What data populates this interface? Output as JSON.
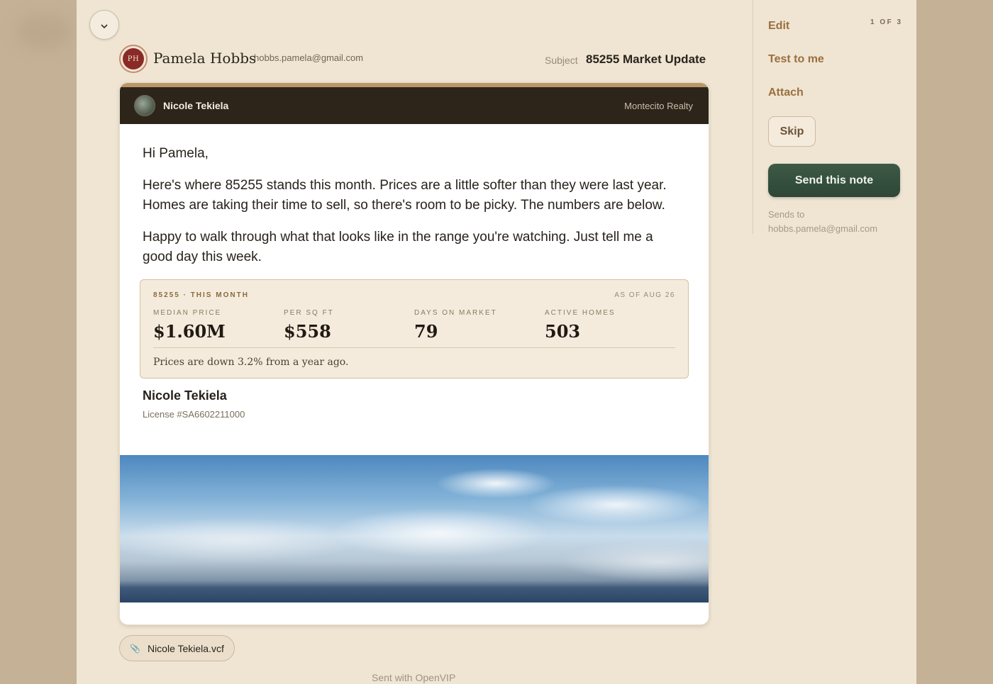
{
  "header": {
    "recipient_initials": "PH",
    "recipient_name": "Pamela Hobbs",
    "recipient_email": "hobbs.pamela@gmail.com",
    "subject_label": "Subject",
    "subject_value": "85255 Market Update"
  },
  "email": {
    "agent_name": "Nicole Tekiela",
    "agency": "Montecito Realty",
    "greeting": "Hi Pamela,",
    "paragraph1": "Here's where 85255 stands this month. Prices are a little softer than they were last year. Homes are taking their time to sell, so there's room to be picky. The numbers are below.",
    "paragraph2": "Happy to walk through what that looks like in the range you're watching. Just tell me a good day this week.",
    "stats": {
      "title": "85255 · THIS MONTH",
      "as_of": "AS OF AUG 26",
      "items": [
        {
          "label": "MEDIAN PRICE",
          "value": "$1.60M"
        },
        {
          "label": "PER SQ FT",
          "value": "$558"
        },
        {
          "label": "DAYS ON MARKET",
          "value": "79"
        },
        {
          "label": "ACTIVE HOMES",
          "value": "503"
        }
      ],
      "note": "Prices are down 3.2% from a year ago."
    },
    "signature_name": "Nicole Tekiela",
    "signature_license": "License #SA6602211000"
  },
  "attachment": {
    "filename": "Nicole Tekiela.vcf",
    "icon": "paperclip-icon"
  },
  "footer": {
    "sent_with": "Sent with OpenVIP"
  },
  "sidebar": {
    "counter": "1 OF 3",
    "edit": "Edit",
    "test": "Test to me",
    "attach": "Attach",
    "skip": "Skip",
    "send": "Send this note",
    "sends_to_label": "Sends to",
    "sends_to_email": "hobbs.pamela@gmail.com"
  },
  "colors": {
    "background": "#c4b196",
    "panel": "#f0e5d3",
    "accent": "#99703f",
    "send_button": "#2e4636",
    "header_dark": "#2e251a"
  }
}
